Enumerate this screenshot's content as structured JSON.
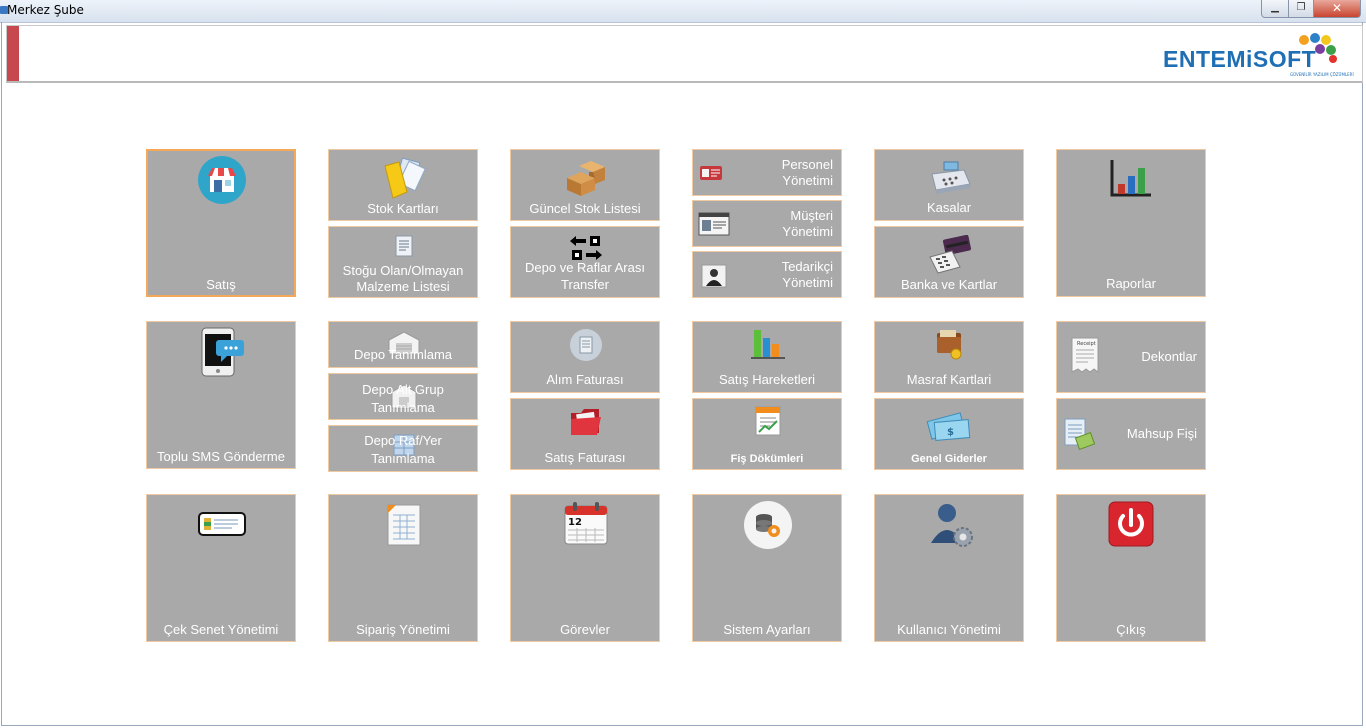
{
  "window": {
    "title": "Merkez Şube",
    "minimize_glyph": "▁",
    "maximize_glyph": "❐",
    "close_glyph": "✕"
  },
  "header": {
    "logo_text": "ENTEMiSOFT",
    "logo_tagline": "GÜVENİLİR YAZILIM ÇÖZÜMLERİ",
    "accent_color": "#c8484f"
  },
  "colors": {
    "tile_bg": "#a9a9a9",
    "tile_border": "#f1c9a0",
    "active_border": "#f5a85a"
  },
  "tiles": {
    "satis": "Satış",
    "stok_kartlari": "Stok Kartları",
    "stogu_olan_line1": "Stoğu Olan/Olmayan",
    "stogu_olan_line2": "Malzeme Listesi",
    "guncel_stok": "Güncel Stok Listesi",
    "depo_transfer_line1": "Depo ve Raflar Arası",
    "depo_transfer_line2": "Transfer",
    "personel_line1": "Personel",
    "personel_line2": "Yönetimi",
    "musteri_line1": "Müşteri",
    "musteri_line2": "Yönetimi",
    "tedarikci_line1": "Tedarikçi",
    "tedarikci_line2": "Yönetimi",
    "kasalar": "Kasalar",
    "banka": "Banka ve Kartlar",
    "raporlar": "Raporlar",
    "toplu_sms": "Toplu SMS Gönderme",
    "depo_tanimlama": "Depo Tanımlama",
    "depo_alt_grup_line1": "Depo Alt Grup",
    "depo_alt_grup_line2": "Tanımlama",
    "depo_raf_line1": "Depo Raf/Yer",
    "depo_raf_line2": "Tanımlama",
    "alim_faturasi": "Alım Faturası",
    "satis_faturasi": "Satış Faturası",
    "satis_hareketleri": "Satış Hareketleri",
    "fis_dokumleri": "Fiş Dökümleri",
    "masraf_kartlari": "Masraf Kartlari",
    "genel_giderler": "Genel Giderler",
    "dekontlar": "Dekontlar",
    "mahsup_fisi": "Mahsup Fişi",
    "cek_senet": "Çek Senet Yönetimi",
    "siparis": "Sipariş Yönetimi",
    "gorevler": "Görevler",
    "sistem_ayarlari": "Sistem Ayarları",
    "kullanici": "Kullanıcı Yönetimi",
    "cikis": "Çıkış",
    "calendar_day": "12",
    "receipt_header": "Receipt"
  }
}
